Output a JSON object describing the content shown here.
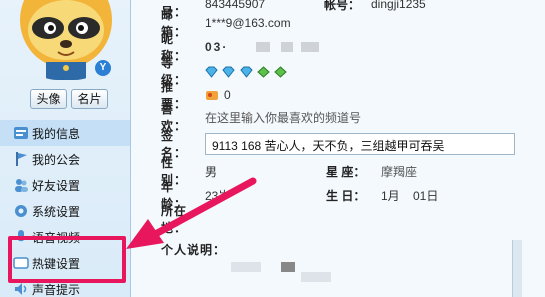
{
  "profile": {
    "id_label": "YY号：",
    "id_value": "843445907",
    "account_label": "帐号：",
    "account_value": "dingji1235",
    "email_label": "邮 箱：",
    "email_value": "1***9@163.com",
    "nick_label": "昵 称：",
    "nick_value": "03·",
    "level_label": "等 级：",
    "recommend_label": "推 票：",
    "recommend_value": "0",
    "like_label": "喜 欢：",
    "like_placeholder": "在这里输入你最喜欢的频道号",
    "sign_label": "签 名：",
    "sign_value": "9113 168 苦心人，天不负，三组越甲可吞吴",
    "sex_label": "性 别：",
    "sex_value": "男",
    "constellation_label": "星 座：",
    "constellation_value": "摩羯座",
    "age_label": "年 龄：",
    "age_value": "23岁",
    "birthday_label": "生 日：",
    "birthday_value": "1月    01日",
    "location_label": "所在地：",
    "intro_label": "个人说明："
  },
  "buttons": {
    "avatar": "头像",
    "card": "名片"
  },
  "badge_v": "Y",
  "nav": [
    {
      "label": "我的信息",
      "icon": "info-icon"
    },
    {
      "label": "我的公会",
      "icon": "flag-icon"
    },
    {
      "label": "好友设置",
      "icon": "friends-icon"
    },
    {
      "label": "系统设置",
      "icon": "gear-icon"
    },
    {
      "label": "语音视频",
      "icon": "voice-icon"
    },
    {
      "label": "热键设置",
      "icon": "keyboard-icon"
    },
    {
      "label": "声音提示",
      "icon": "speaker-icon"
    }
  ],
  "colors": {
    "highlight": "#e8175d",
    "arrow": "#e8175d",
    "accent": "#2b7fd4"
  }
}
